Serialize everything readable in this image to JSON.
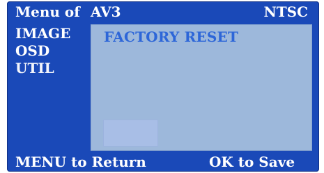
{
  "header": {
    "menu_title": "Menu of",
    "source": "AV3",
    "standard": "NTSC"
  },
  "sidebar": {
    "items": [
      {
        "label": "IMAGE"
      },
      {
        "label": "OSD"
      },
      {
        "label": "UTIL"
      }
    ]
  },
  "main": {
    "option": "FACTORY RESET"
  },
  "footer": {
    "left_hint": "MENU to Return",
    "right_hint": "OK to Save"
  },
  "colors": {
    "background": "#1a49b8",
    "panel": "#9db8db",
    "selected_text": "#2d66d8",
    "text": "#ffffff"
  }
}
